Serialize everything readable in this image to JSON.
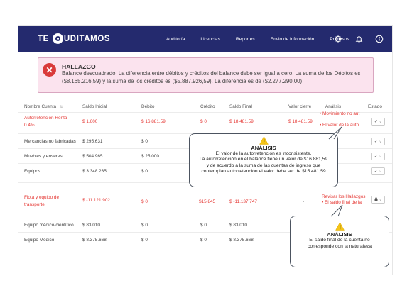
{
  "brand": {
    "prefix": "TE",
    "suffix": "UDITAMOS"
  },
  "nav": {
    "links": [
      "Auditoría",
      "Licencias",
      "Reportes",
      "Envio de información",
      "Procesos"
    ]
  },
  "alert": {
    "title": "HALLAZGO",
    "text": "Balance descuadrado. La diferencia entre débitos y créditos del balance debe ser igual a cero. La suma de los Débitos es ($8.165.216,59) y la suma de los créditos es ($5.887.926,59). La diferencia es de ($2.277.290,00)"
  },
  "table": {
    "headers": [
      "Nombre Cuenta",
      "Saldo Inicial",
      "Débito",
      "Crédito",
      "Saldo Final",
      "Valor cierre",
      "Análisis",
      "Estado"
    ],
    "rows": [
      {
        "name": "Autorretención Renta 0.4%",
        "inicial": "$ 1.600",
        "debito": "$ 16.881,59",
        "credito": "$ 0",
        "final": "$ 18.481,59",
        "cierre": "$ 18.481,59",
        "analisis1": "Movimiento no aut",
        "analisis2": "El valor de la auto",
        "estado": "✓"
      },
      {
        "name": "Mercancias no fabricadas",
        "inicial": "$ 295.631",
        "debito": "$ 0",
        "estado": "✓"
      },
      {
        "name": "Muebles y enseres",
        "inicial": "$ 504.965",
        "debito": "$ 25.000",
        "estado": "✓"
      },
      {
        "name": "Equipos",
        "inicial": "$ 3.348.235",
        "debito": "$ 0",
        "estado": "✓"
      },
      {
        "name": "Flota y equipo de transporte",
        "inicial": "$ -11.121.902",
        "debito": "$ 0",
        "credito": "$15.845",
        "final": "$ -11.137.747",
        "cierre": "-",
        "analisis1": "Revisar los Hallazgos",
        "analisis2": "El saldo final de la",
        "estado": "🔒"
      },
      {
        "name": "Equipo médico-científico",
        "inicial": "$ 83.010",
        "debito": "$ 0",
        "credito": "$ 0",
        "final": "$ 83.010"
      },
      {
        "name": "Equipo Medico",
        "inicial": "$ 8.375.668",
        "debito": "$ 0",
        "credito": "$ 0",
        "final": "$ 8.375.668"
      }
    ]
  },
  "analysis_popup_1": {
    "title": "ANÁLISIS",
    "lines": [
      "El valor de la autorretención es inconsistente.",
      "La autorretención en el balance tiene un valor de $16.881,59",
      "y de acuerdo a la suma de las cuentas de ingreso que",
      "contemplan autorretención el valor debe ser de $15.481,59"
    ]
  },
  "analysis_popup_2": {
    "title": "ANÁLISIS",
    "lines": [
      "El saldo final de la cuenta no",
      "corresponde con la naturaleza"
    ]
  },
  "colors": {
    "navbar": "#242a6e",
    "alert_bg": "#fbe3ee",
    "alert_icon": "#d93a3a",
    "negative": "#e53935",
    "warning": "#f5c518"
  },
  "icons": [
    "settings-icon",
    "bell-icon",
    "info-icon",
    "error-icon",
    "warning-icon",
    "check-icon",
    "lock-icon"
  ]
}
